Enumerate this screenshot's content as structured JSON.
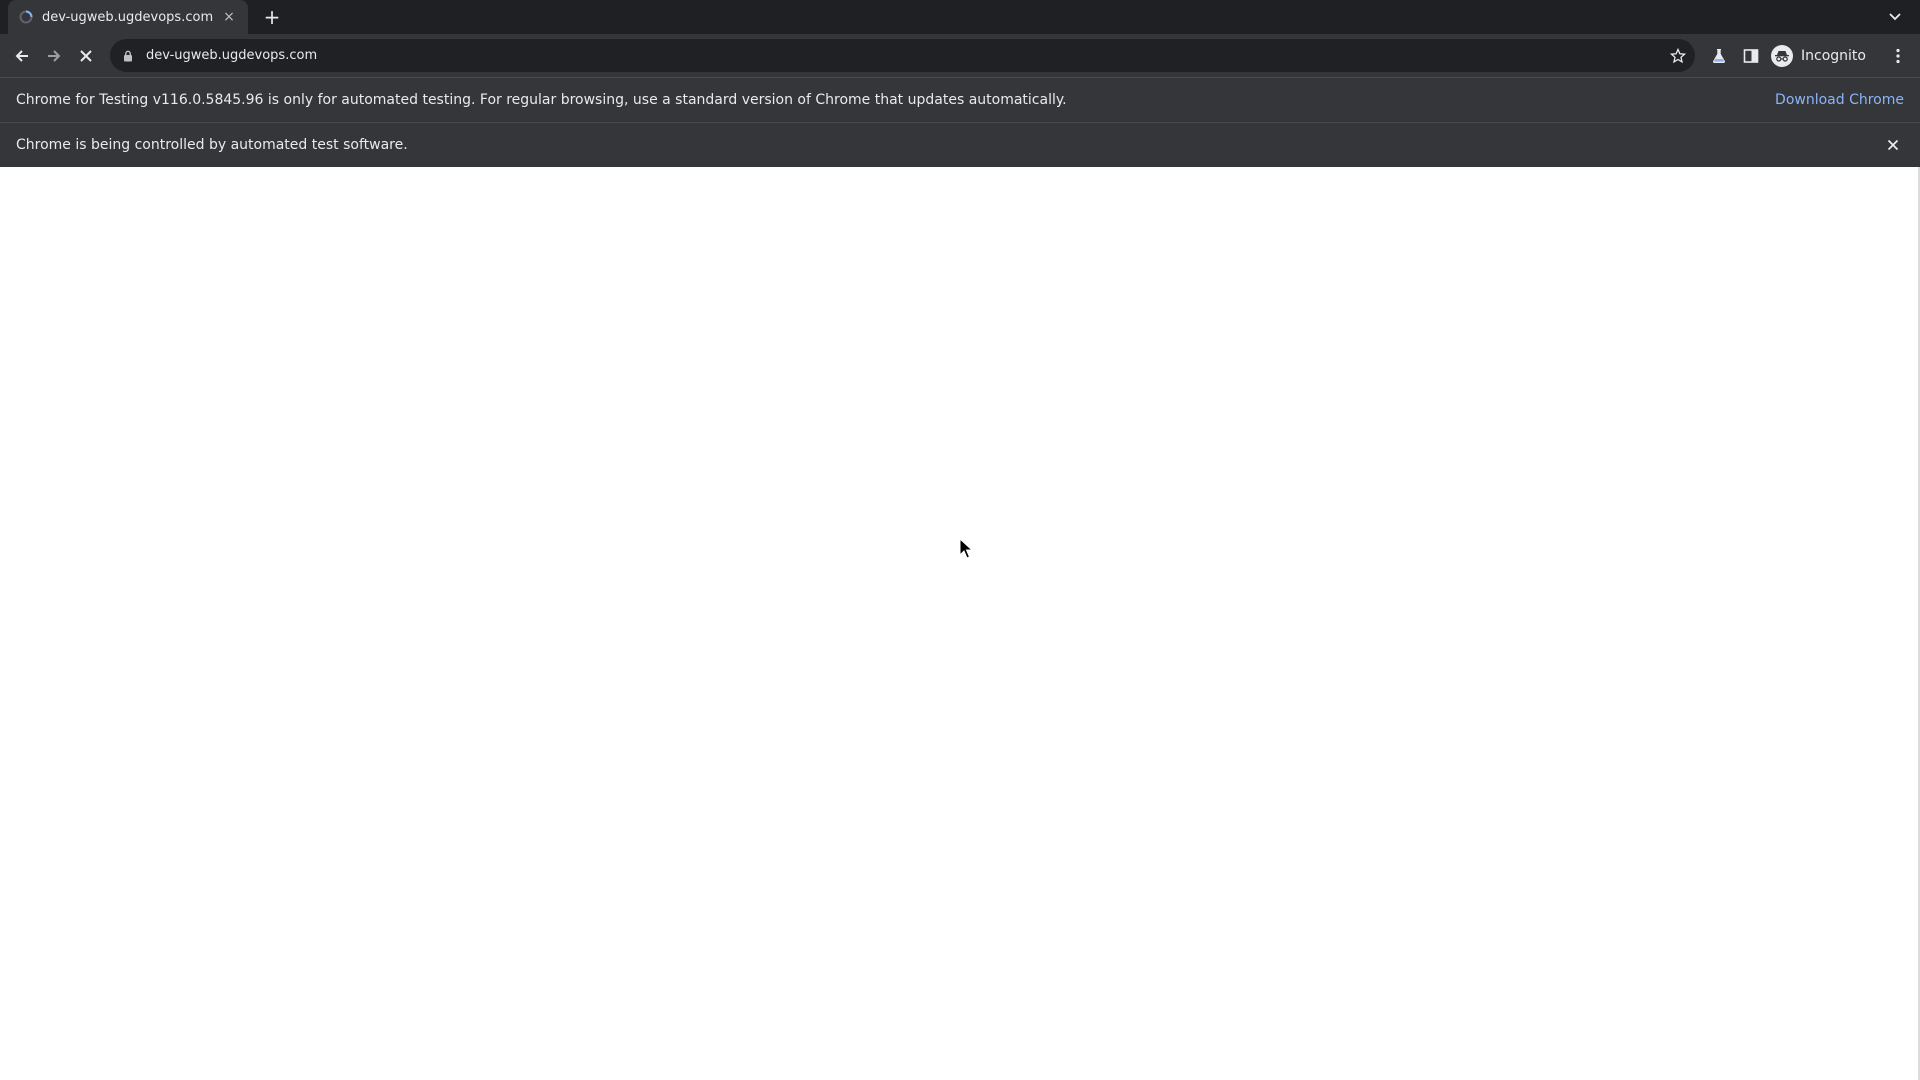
{
  "browser": {
    "tab": {
      "title": "dev-ugweb.ugdevops.com",
      "close_glyph": "×"
    },
    "new_tab_glyph": "+",
    "toolbar": {
      "url": "dev-ugweb.ugdevops.com",
      "profile_label": "Incognito"
    },
    "icons": {
      "back": "arrow-left-icon",
      "forward": "arrow-right-icon",
      "stop": "stop-loading-icon",
      "lock": "lock-icon",
      "star": "star-icon",
      "labs": "flask-icon",
      "side_panel": "side-panel-icon",
      "incognito": "incognito-icon",
      "menu": "kebab-menu-icon",
      "tab_search": "chevron-down-icon"
    },
    "colors": {
      "frame": "#1f2023",
      "toolbar": "#35363a",
      "omnibox": "#202124",
      "text": "#e8eaed",
      "link": "#8ab4f8",
      "favicon": "#8ab4f8"
    }
  },
  "infobars": {
    "testing_notice": {
      "text": "Chrome for Testing v116.0.5845.96 is only for automated testing. For regular browsing, use a standard version of Chrome that updates automatically.",
      "link": "Download Chrome"
    },
    "automation_notice": {
      "text": "Chrome is being controlled by automated test software.",
      "close_glyph": "✕"
    }
  },
  "page": {
    "state": "blank"
  }
}
